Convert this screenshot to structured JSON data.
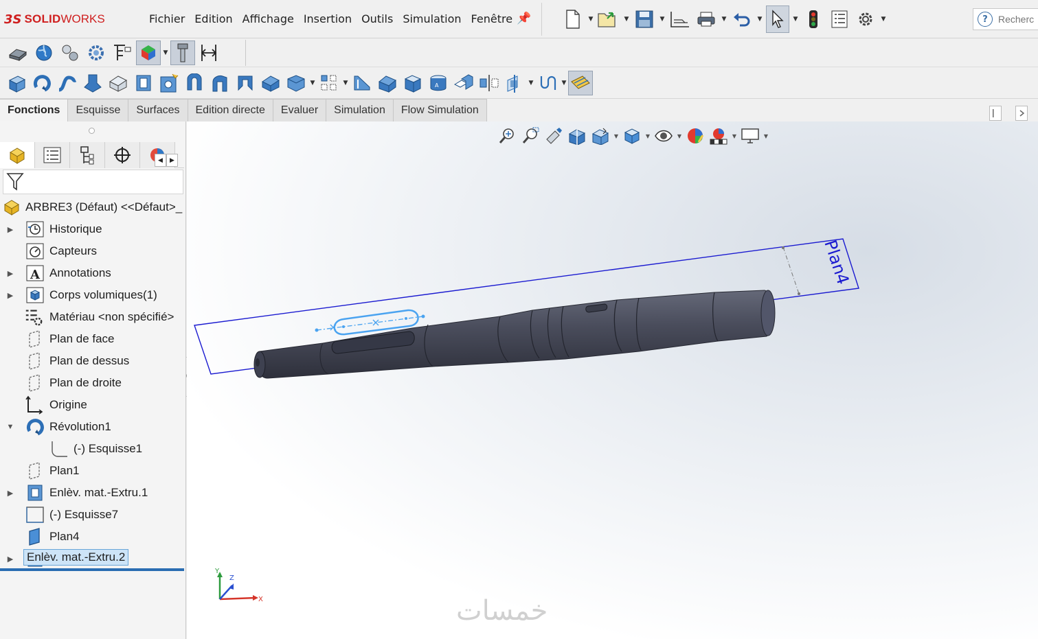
{
  "app": {
    "brand_ds": "3S",
    "brand_solid": "SOLID",
    "brand_works": "WORKS"
  },
  "menu": [
    {
      "label": "Fichier"
    },
    {
      "label": "Edition"
    },
    {
      "label": "Affichage"
    },
    {
      "label": "Insertion"
    },
    {
      "label": "Outils"
    },
    {
      "label": "Simulation"
    },
    {
      "label": "Fenêtre"
    }
  ],
  "search": {
    "placeholder": "Recherc"
  },
  "tabs": [
    {
      "label": "Fonctions",
      "active": true
    },
    {
      "label": "Esquisse"
    },
    {
      "label": "Surfaces"
    },
    {
      "label": "Edition directe"
    },
    {
      "label": "Evaluer"
    },
    {
      "label": "Simulation"
    },
    {
      "label": "Flow Simulation"
    }
  ],
  "tree": {
    "root": "ARBRE3 (Défaut) <<Défaut>_",
    "items": [
      {
        "label": "Historique",
        "icon": "history-folder-icon",
        "expandable": true
      },
      {
        "label": "Capteurs",
        "icon": "sensor-icon",
        "expandable": false
      },
      {
        "label": "Annotations",
        "icon": "annotation-icon",
        "expandable": true
      },
      {
        "label": "Corps volumiques(1)",
        "icon": "solid-body-icon",
        "expandable": true
      },
      {
        "label": "Matériau <non spécifié>",
        "icon": "material-icon",
        "expandable": false
      },
      {
        "label": "Plan de face",
        "icon": "plane-icon",
        "expandable": false
      },
      {
        "label": "Plan de dessus",
        "icon": "plane-icon",
        "expandable": false
      },
      {
        "label": "Plan de droite",
        "icon": "plane-icon",
        "expandable": false
      },
      {
        "label": "Origine",
        "icon": "origin-icon",
        "expandable": false
      },
      {
        "label": "Révolution1",
        "icon": "revolve-icon",
        "expandable": true,
        "expanded": true
      },
      {
        "label": "(-) Esquisse1",
        "icon": "sketch-icon",
        "expandable": false,
        "indent": 1
      },
      {
        "label": "Plan1",
        "icon": "plane-icon",
        "expandable": false
      },
      {
        "label": "Enlèv. mat.-Extru.1",
        "icon": "cut-extrude-icon",
        "expandable": true
      },
      {
        "label": "(-) Esquisse7",
        "icon": "sketch-icon",
        "expandable": false
      },
      {
        "label": "Plan4",
        "icon": "plane-active-icon",
        "expandable": false
      },
      {
        "label": "Enlèv. mat.-Extru.2",
        "icon": "cut-extrude-icon",
        "expandable": true,
        "selected": true
      }
    ]
  },
  "viewport": {
    "plane_label": "Plan4",
    "triad": {
      "x": "X",
      "y": "Y",
      "z": "Z"
    },
    "watermark": "خمسات"
  },
  "colors": {
    "brand_red": "#cf1f1f",
    "plane_blue": "#1a1ad0",
    "sketch_blue": "#4aa3f0",
    "part_body": "#4a4d5c",
    "selection": "#cde4f7"
  }
}
